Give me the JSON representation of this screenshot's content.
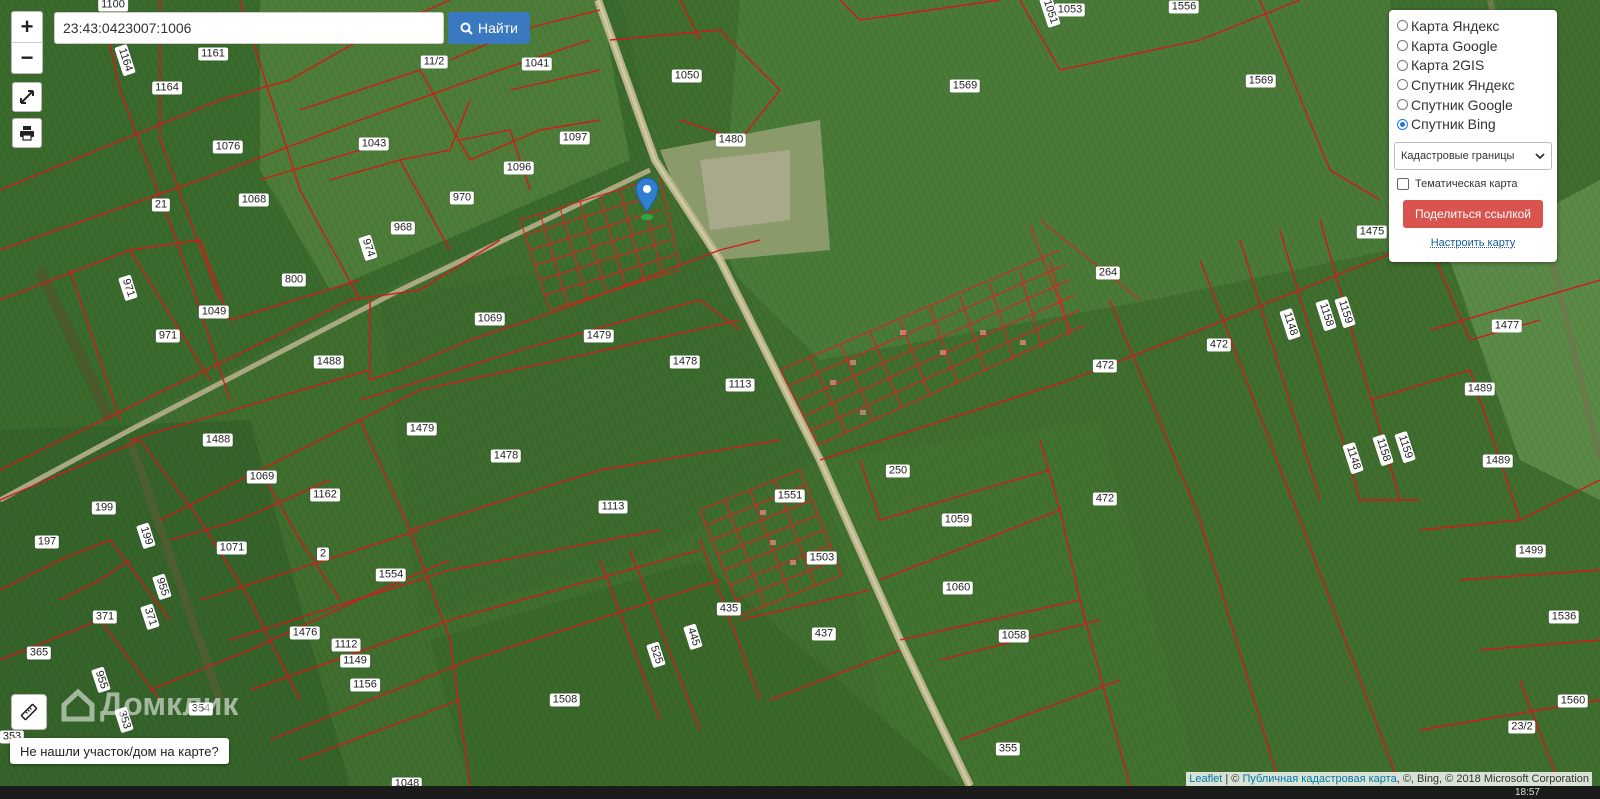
{
  "search": {
    "value": "23:43:0423007:1006",
    "button_label": "Найти"
  },
  "zoom": {
    "in_label": "+",
    "out_label": "−"
  },
  "layers": {
    "base_options": [
      {
        "label": "Карта Яндекс",
        "selected": false
      },
      {
        "label": "Карта Google",
        "selected": false
      },
      {
        "label": "Карта 2GIS",
        "selected": false
      },
      {
        "label": "Спутник Яндекс",
        "selected": false
      },
      {
        "label": "Спутник Google",
        "selected": false
      },
      {
        "label": "Спутник Bing",
        "selected": true
      }
    ],
    "overlay_select": "Кадастровые границы",
    "thematic_label": "Тематическая карта",
    "thematic_checked": false,
    "share_button": "Поделиться ссылкой",
    "customize_link": "Настроить карту"
  },
  "not_found_button": "Не нашли участок/дом на карте?",
  "watermark": "Домклик",
  "attribution": {
    "leaflet": "Leaflet",
    "separator": " | © ",
    "cadastral": "Публичная кадастровая карта",
    "rest": ", ©, Bing, © 2018 Microsoft Corporation"
  },
  "clock": "18:57",
  "colors": {
    "boundary": "#d11a1a",
    "field": "#3d6b2c",
    "marker": "#2f7fd3",
    "share": "#d9534f"
  },
  "icons": [
    "plus-icon",
    "minus-icon",
    "fullscreen-icon",
    "print-icon",
    "search-icon",
    "ruler-icon",
    "map-pin-icon",
    "house-icon"
  ],
  "plot_labels": [
    {
      "t": "1100"
    },
    {
      "t": "1556"
    },
    {
      "t": "1053"
    },
    {
      "t": "1051",
      "r": true
    },
    {
      "t": "1164",
      "r": true
    },
    {
      "t": "1161"
    },
    {
      "t": "11/2"
    },
    {
      "t": "1041"
    },
    {
      "t": "1050"
    },
    {
      "t": "1569"
    },
    {
      "t": "1569"
    },
    {
      "t": "1164"
    },
    {
      "t": "1076"
    },
    {
      "t": "1043"
    },
    {
      "t": "1097"
    },
    {
      "t": "1480"
    },
    {
      "t": "1096"
    },
    {
      "t": "21"
    },
    {
      "t": "1068"
    },
    {
      "t": "970"
    },
    {
      "t": "968"
    },
    {
      "t": "974",
      "r": true
    },
    {
      "t": "800"
    },
    {
      "t": "971",
      "r": true
    },
    {
      "t": "264"
    },
    {
      "t": "1475"
    },
    {
      "t": "971"
    },
    {
      "t": "1049"
    },
    {
      "t": "1069"
    },
    {
      "t": "1479"
    },
    {
      "t": "1148",
      "r": true
    },
    {
      "t": "1158",
      "r": true
    },
    {
      "t": "1159",
      "r": true
    },
    {
      "t": "1477"
    },
    {
      "t": "472"
    },
    {
      "t": "472"
    },
    {
      "t": "1488"
    },
    {
      "t": "1478"
    },
    {
      "t": "1113"
    },
    {
      "t": "1489"
    },
    {
      "t": "1479"
    },
    {
      "t": "1488"
    },
    {
      "t": "1478"
    },
    {
      "t": "1148",
      "r": true
    },
    {
      "t": "1158",
      "r": true
    },
    {
      "t": "1159",
      "r": true
    },
    {
      "t": "1489"
    },
    {
      "t": "250"
    },
    {
      "t": "1069"
    },
    {
      "t": "1162"
    },
    {
      "t": "199"
    },
    {
      "t": "1113"
    },
    {
      "t": "1551"
    },
    {
      "t": "472"
    },
    {
      "t": "197"
    },
    {
      "t": "199",
      "r": true
    },
    {
      "t": "1071"
    },
    {
      "t": "2"
    },
    {
      "t": "1059"
    },
    {
      "t": "1499"
    },
    {
      "t": "1503"
    },
    {
      "t": "955",
      "r": true
    },
    {
      "t": "1554"
    },
    {
      "t": "1060"
    },
    {
      "t": "371"
    },
    {
      "t": "371",
      "r": true
    },
    {
      "t": "435"
    },
    {
      "t": "1536"
    },
    {
      "t": "1476"
    },
    {
      "t": "445",
      "r": true
    },
    {
      "t": "437"
    },
    {
      "t": "1058"
    },
    {
      "t": "365"
    },
    {
      "t": "1112"
    },
    {
      "t": "1149"
    },
    {
      "t": "525",
      "r": true
    },
    {
      "t": "955",
      "r": true
    },
    {
      "t": "1156"
    },
    {
      "t": "1508"
    },
    {
      "t": "1560"
    },
    {
      "t": "353",
      "r": true
    },
    {
      "t": "354"
    },
    {
      "t": "353"
    },
    {
      "t": "23/2"
    },
    {
      "t": "355"
    },
    {
      "t": "1048"
    }
  ]
}
